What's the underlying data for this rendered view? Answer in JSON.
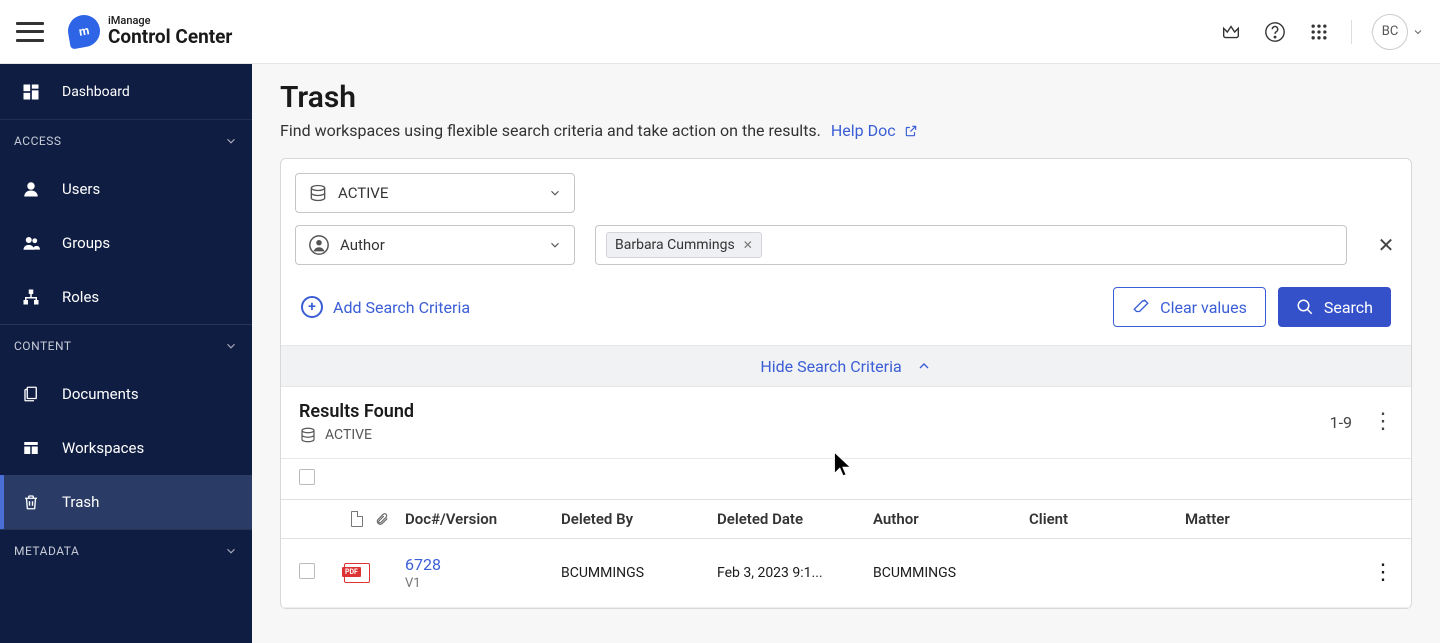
{
  "header": {
    "brand_small": "iManage",
    "brand_large": "Control Center",
    "avatar_initials": "BC"
  },
  "sidebar": {
    "dashboard": "Dashboard",
    "sections": {
      "access": {
        "label": "ACCESS",
        "items": [
          "Users",
          "Groups",
          "Roles"
        ]
      },
      "content": {
        "label": "CONTENT",
        "items": [
          "Documents",
          "Workspaces",
          "Trash"
        ]
      },
      "metadata": {
        "label": "METADATA"
      }
    }
  },
  "page": {
    "title": "Trash",
    "subtitle": "Find workspaces using flexible search criteria and take action on the results.",
    "help_link": "Help Doc"
  },
  "search": {
    "scope_value": "ACTIVE",
    "criteria_type": "Author",
    "tag_value": "Barbara Cummings",
    "add_criteria": "Add Search Criteria",
    "clear_values": "Clear values",
    "search_btn": "Search",
    "hide_criteria": "Hide Search Criteria"
  },
  "results": {
    "title": "Results Found",
    "scope": "ACTIVE",
    "count_range": "1-9",
    "columns": {
      "doc": "Doc#/Version",
      "deleted_by": "Deleted By",
      "deleted_date": "Deleted Date",
      "author": "Author",
      "client": "Client",
      "matter": "Matter"
    },
    "rows": [
      {
        "doc_num": "6728",
        "version": "V1",
        "deleted_by": "BCUMMINGS",
        "deleted_date": "Feb 3, 2023 9:1...",
        "author": "BCUMMINGS",
        "client": "",
        "matter": ""
      }
    ]
  }
}
